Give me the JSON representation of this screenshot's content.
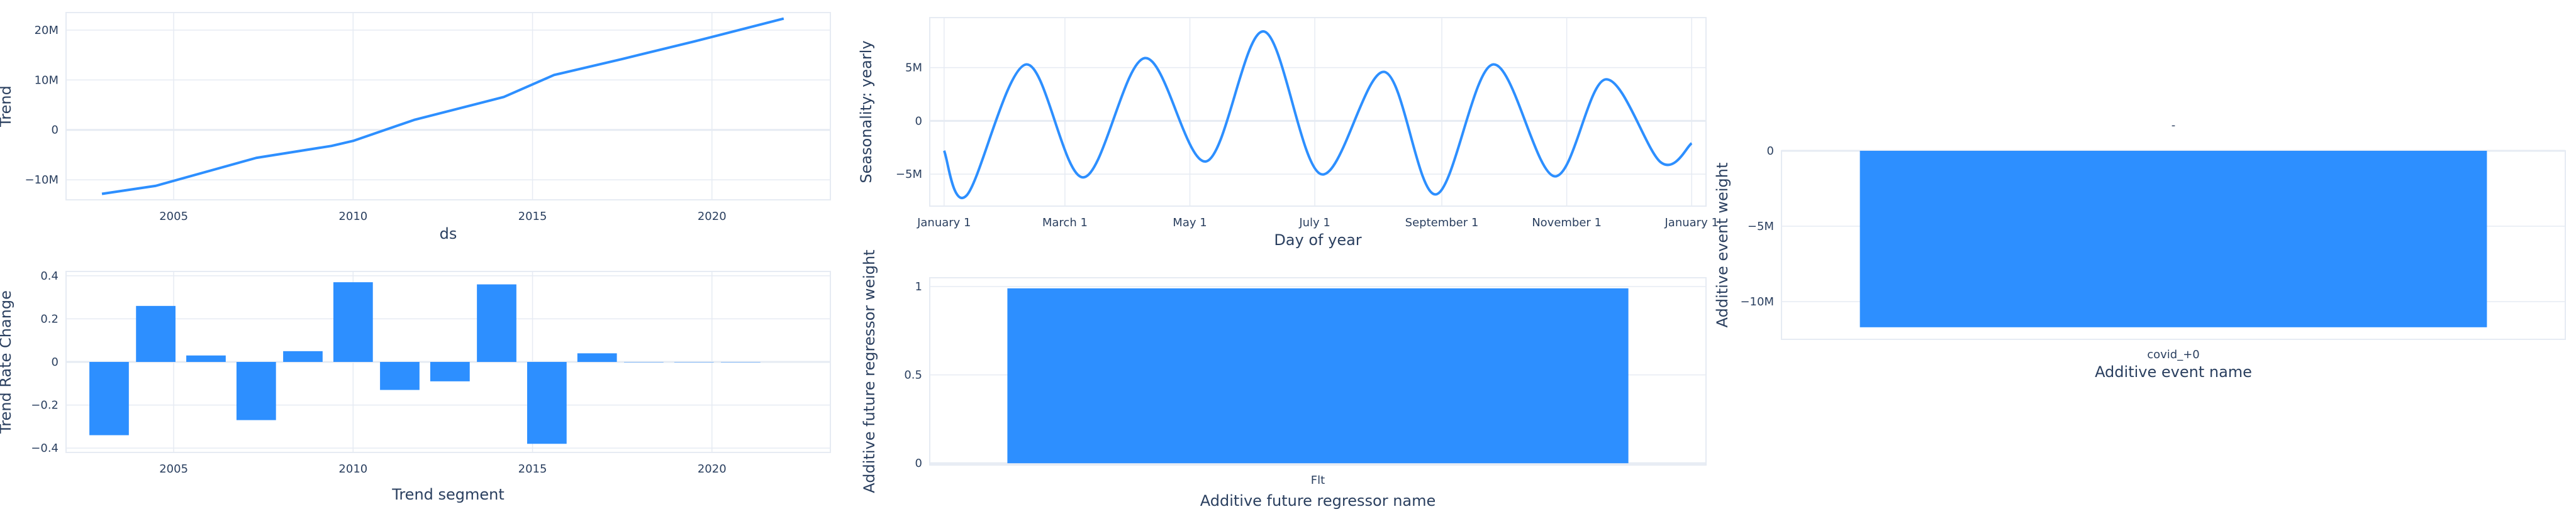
{
  "chart_data": [
    {
      "id": "trend",
      "type": "line",
      "xlabel": "ds",
      "ylabel": "Trend",
      "xlim": [
        2002.0,
        2023.3
      ],
      "ylim": [
        -14000000,
        23500000
      ],
      "xticks": [
        2005,
        2010,
        2015,
        2020
      ],
      "xtick_labels": [
        "2005",
        "2010",
        "2015",
        "2020"
      ],
      "yticks": [
        -10000000,
        0,
        10000000,
        20000000
      ],
      "ytick_labels": [
        "−10M",
        "0",
        "10M",
        "20M"
      ],
      "grid": true,
      "color": "#2d8fff",
      "x": [
        2003.0,
        2004.5,
        2007.3,
        2009.4,
        2010.0,
        2011.7,
        2014.2,
        2015.6,
        2017.5,
        2019.5,
        2022.0
      ],
      "y": [
        -12800000,
        -11200000,
        -5600000,
        -3200000,
        -2200000,
        2000000,
        6600000,
        11000000,
        14200000,
        17700000,
        22300000
      ]
    },
    {
      "id": "trend_rate_change",
      "type": "bar",
      "xlabel": "Trend segment",
      "ylabel": "Trend Rate Change",
      "xlim": [
        2002.0,
        2023.3
      ],
      "ylim": [
        -0.42,
        0.42
      ],
      "xticks": [
        2005,
        2010,
        2015,
        2020
      ],
      "xtick_labels": [
        "2005",
        "2010",
        "2015",
        "2020"
      ],
      "yticks": [
        -0.4,
        -0.2,
        0,
        0.2,
        0.4
      ],
      "ytick_labels": [
        "−0.4",
        "−0.2",
        "0",
        "0.2",
        "0.4"
      ],
      "grid": true,
      "color": "#2d8fff",
      "bar_width": 1.1,
      "x": [
        2003.2,
        2004.5,
        2005.9,
        2007.3,
        2008.6,
        2010.0,
        2011.3,
        2012.7,
        2014.0,
        2015.4,
        2016.8,
        2018.1,
        2019.5,
        2020.8
      ],
      "values": [
        -0.34,
        0.26,
        0.03,
        -0.27,
        0.05,
        0.37,
        -0.13,
        -0.09,
        0.36,
        -0.38,
        0.04,
        0.0,
        0.0,
        0.0
      ]
    },
    {
      "id": "seasonality_yearly",
      "type": "line",
      "xlabel": "Day of year",
      "ylabel": "Seasonality: yearly",
      "xlim": [
        -7,
        372
      ],
      "ylim": [
        -8000000,
        9700000
      ],
      "xticks": [
        0,
        59,
        120,
        181,
        243,
        304,
        365
      ],
      "xtick_labels": [
        "January  1",
        "March  1",
        "May  1",
        "July  1",
        "September  1",
        "November  1",
        "January  1"
      ],
      "yticks": [
        -5000000,
        0,
        5000000
      ],
      "ytick_labels": [
        "−5M",
        "0",
        "5M"
      ],
      "grid": true,
      "color": "#2d8fff",
      "x": [
        0,
        11,
        40,
        68,
        98,
        128,
        156,
        184,
        215,
        240,
        268,
        298,
        323,
        350,
        365
      ],
      "y": [
        -2800000,
        -7000000,
        5300000,
        -5300000,
        5900000,
        -3800000,
        8400000,
        -5000000,
        4600000,
        -6900000,
        5300000,
        -5200000,
        3900000,
        -3900000,
        -2100000
      ]
    },
    {
      "id": "future_regressor",
      "type": "bar",
      "xlabel": "Additive future regressor name",
      "ylabel": "Additive future regressor weight",
      "categories": [
        "Flt"
      ],
      "values": [
        0.99
      ],
      "ylim": [
        -0.01,
        1.05
      ],
      "yticks": [
        0,
        0.5,
        1
      ],
      "ytick_labels": [
        "0",
        "0.5",
        "1"
      ],
      "grid": true,
      "color": "#2d8fff"
    },
    {
      "id": "event_weight",
      "type": "bar",
      "title": "-",
      "xlabel": "Additive event name",
      "ylabel": "Additive event weight",
      "categories": [
        "covid_+0"
      ],
      "values": [
        -11700000
      ],
      "ylim": [
        -12500000,
        0
      ],
      "yticks": [
        -10000000,
        -5000000,
        0
      ],
      "ytick_labels": [
        "−10M",
        "−5M",
        "0"
      ],
      "grid": true,
      "color": "#2d8fff"
    }
  ]
}
